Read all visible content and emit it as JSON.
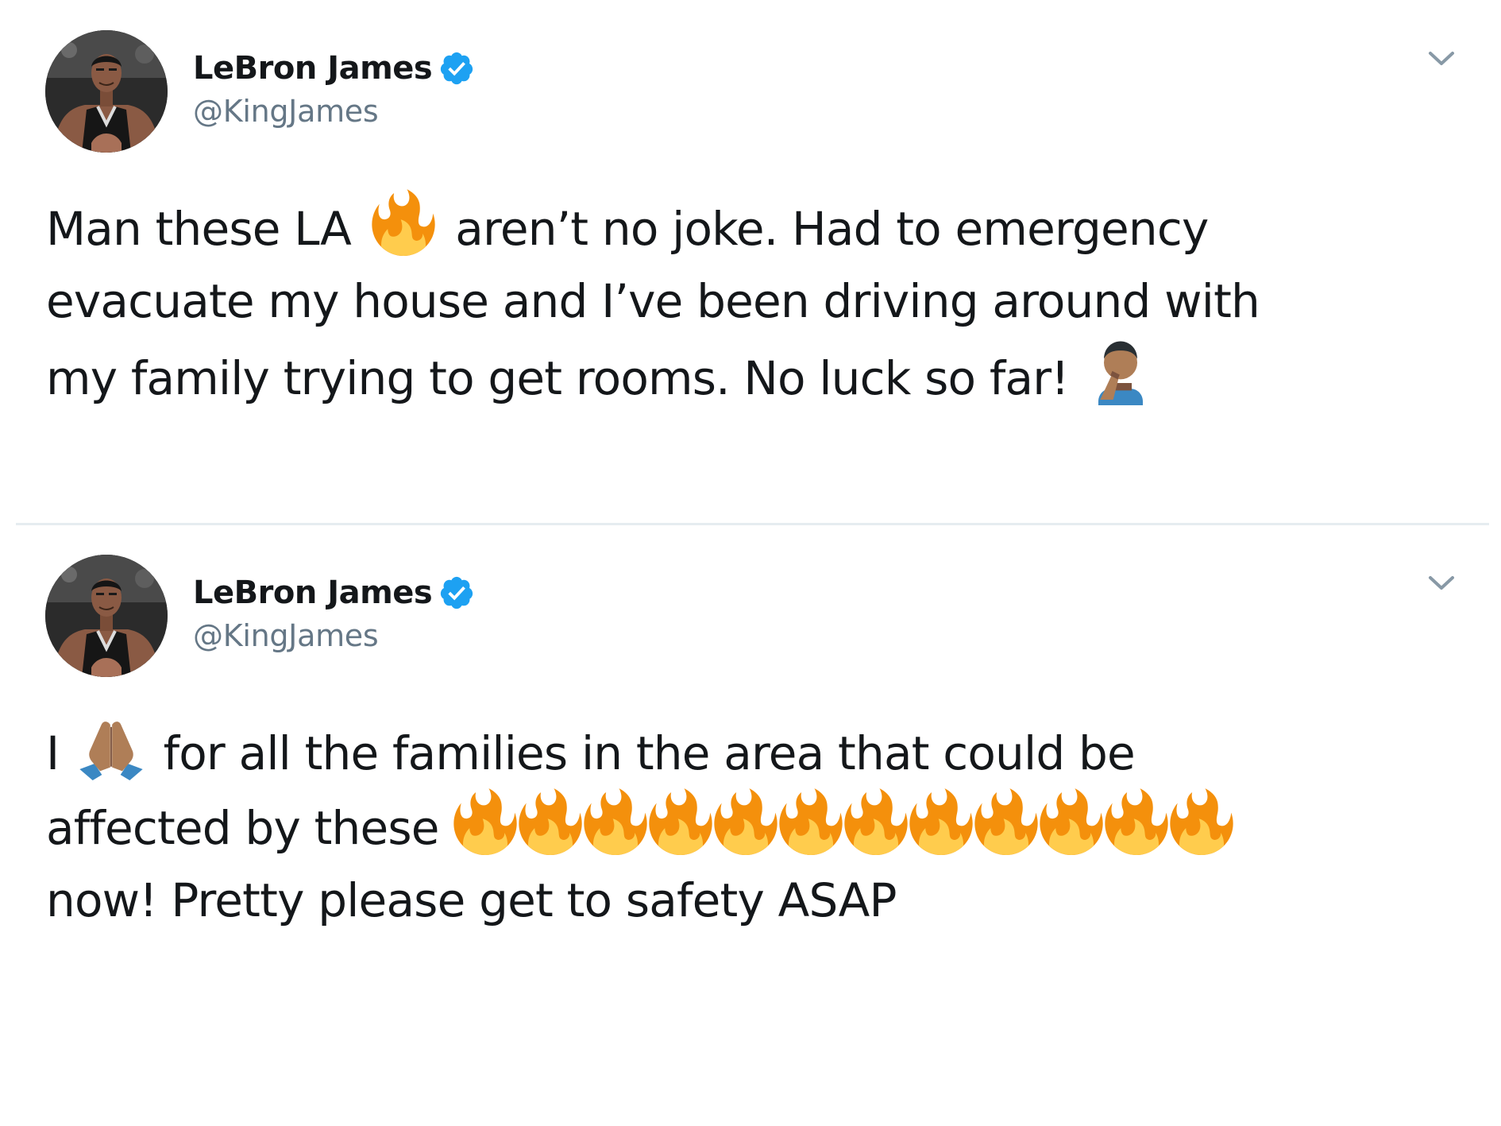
{
  "tweets": [
    {
      "author": {
        "name": "LeBron James",
        "handle": "@KingJames",
        "verified": true
      },
      "text_lines": [
        [
          "Man these LA ",
          {
            "emoji": "fire-icon"
          },
          " aren’t no joke. Had to emergency"
        ],
        [
          "evacuate my house and I’ve been driving around with"
        ],
        [
          "my family trying to get rooms. No luck so far! ",
          {
            "emoji": "man-facepalming-icon"
          }
        ]
      ]
    },
    {
      "author": {
        "name": "LeBron James",
        "handle": "@KingJames",
        "verified": true
      },
      "text_lines": [
        [
          "I ",
          {
            "emoji": "folded-hands-icon"
          },
          " for all the families in the area that could be"
        ],
        [
          "affected by these ",
          {
            "emoji": "fire-icon"
          },
          {
            "emoji": "fire-icon"
          },
          {
            "emoji": "fire-icon"
          },
          {
            "emoji": "fire-icon"
          },
          {
            "emoji": "fire-icon"
          },
          {
            "emoji": "fire-icon"
          },
          {
            "emoji": "fire-icon"
          },
          {
            "emoji": "fire-icon"
          },
          {
            "emoji": "fire-icon"
          },
          {
            "emoji": "fire-icon"
          },
          {
            "emoji": "fire-icon"
          },
          {
            "emoji": "fire-icon"
          }
        ],
        [
          "now! Pretty please get to safety ASAP"
        ]
      ]
    }
  ],
  "colors": {
    "text": "#14171a",
    "handle": "#657786",
    "verified": "#1da1f2",
    "divider": "#e6ecf0",
    "caret": "#8899a6"
  }
}
